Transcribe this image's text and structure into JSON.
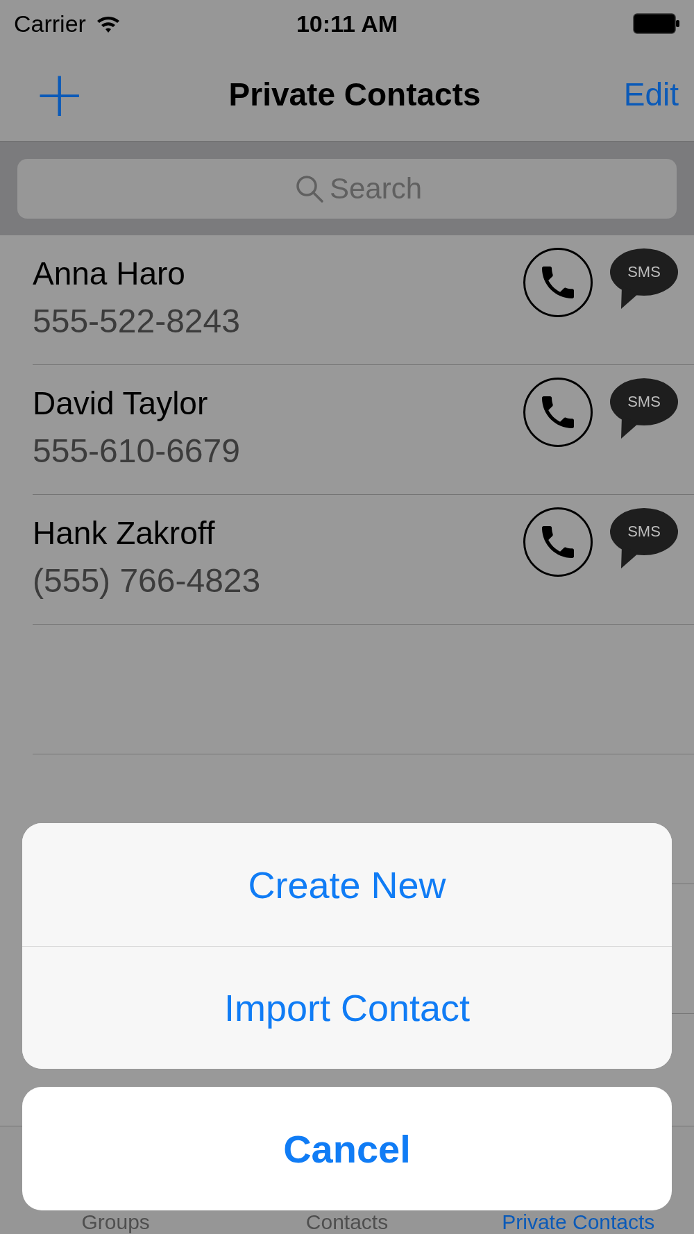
{
  "status_bar": {
    "carrier": "Carrier",
    "time": "10:11 AM"
  },
  "nav_bar": {
    "add": "+",
    "title": "Private Contacts",
    "edit": "Edit"
  },
  "search": {
    "placeholder": "Search"
  },
  "contacts": [
    {
      "name": "Anna Haro",
      "phone": "555-522-8243",
      "sms": "SMS"
    },
    {
      "name": "David Taylor",
      "phone": "555-610-6679",
      "sms": "SMS"
    },
    {
      "name": "Hank Zakroff",
      "phone": "(555) 766-4823",
      "sms": "SMS"
    }
  ],
  "tabs": [
    {
      "label": "Groups",
      "selected": false
    },
    {
      "label": "Contacts",
      "selected": false
    },
    {
      "label": "Private Contacts",
      "selected": true
    }
  ],
  "action_sheet": {
    "actions": [
      "Create New",
      "Import Contact"
    ],
    "cancel": "Cancel"
  }
}
